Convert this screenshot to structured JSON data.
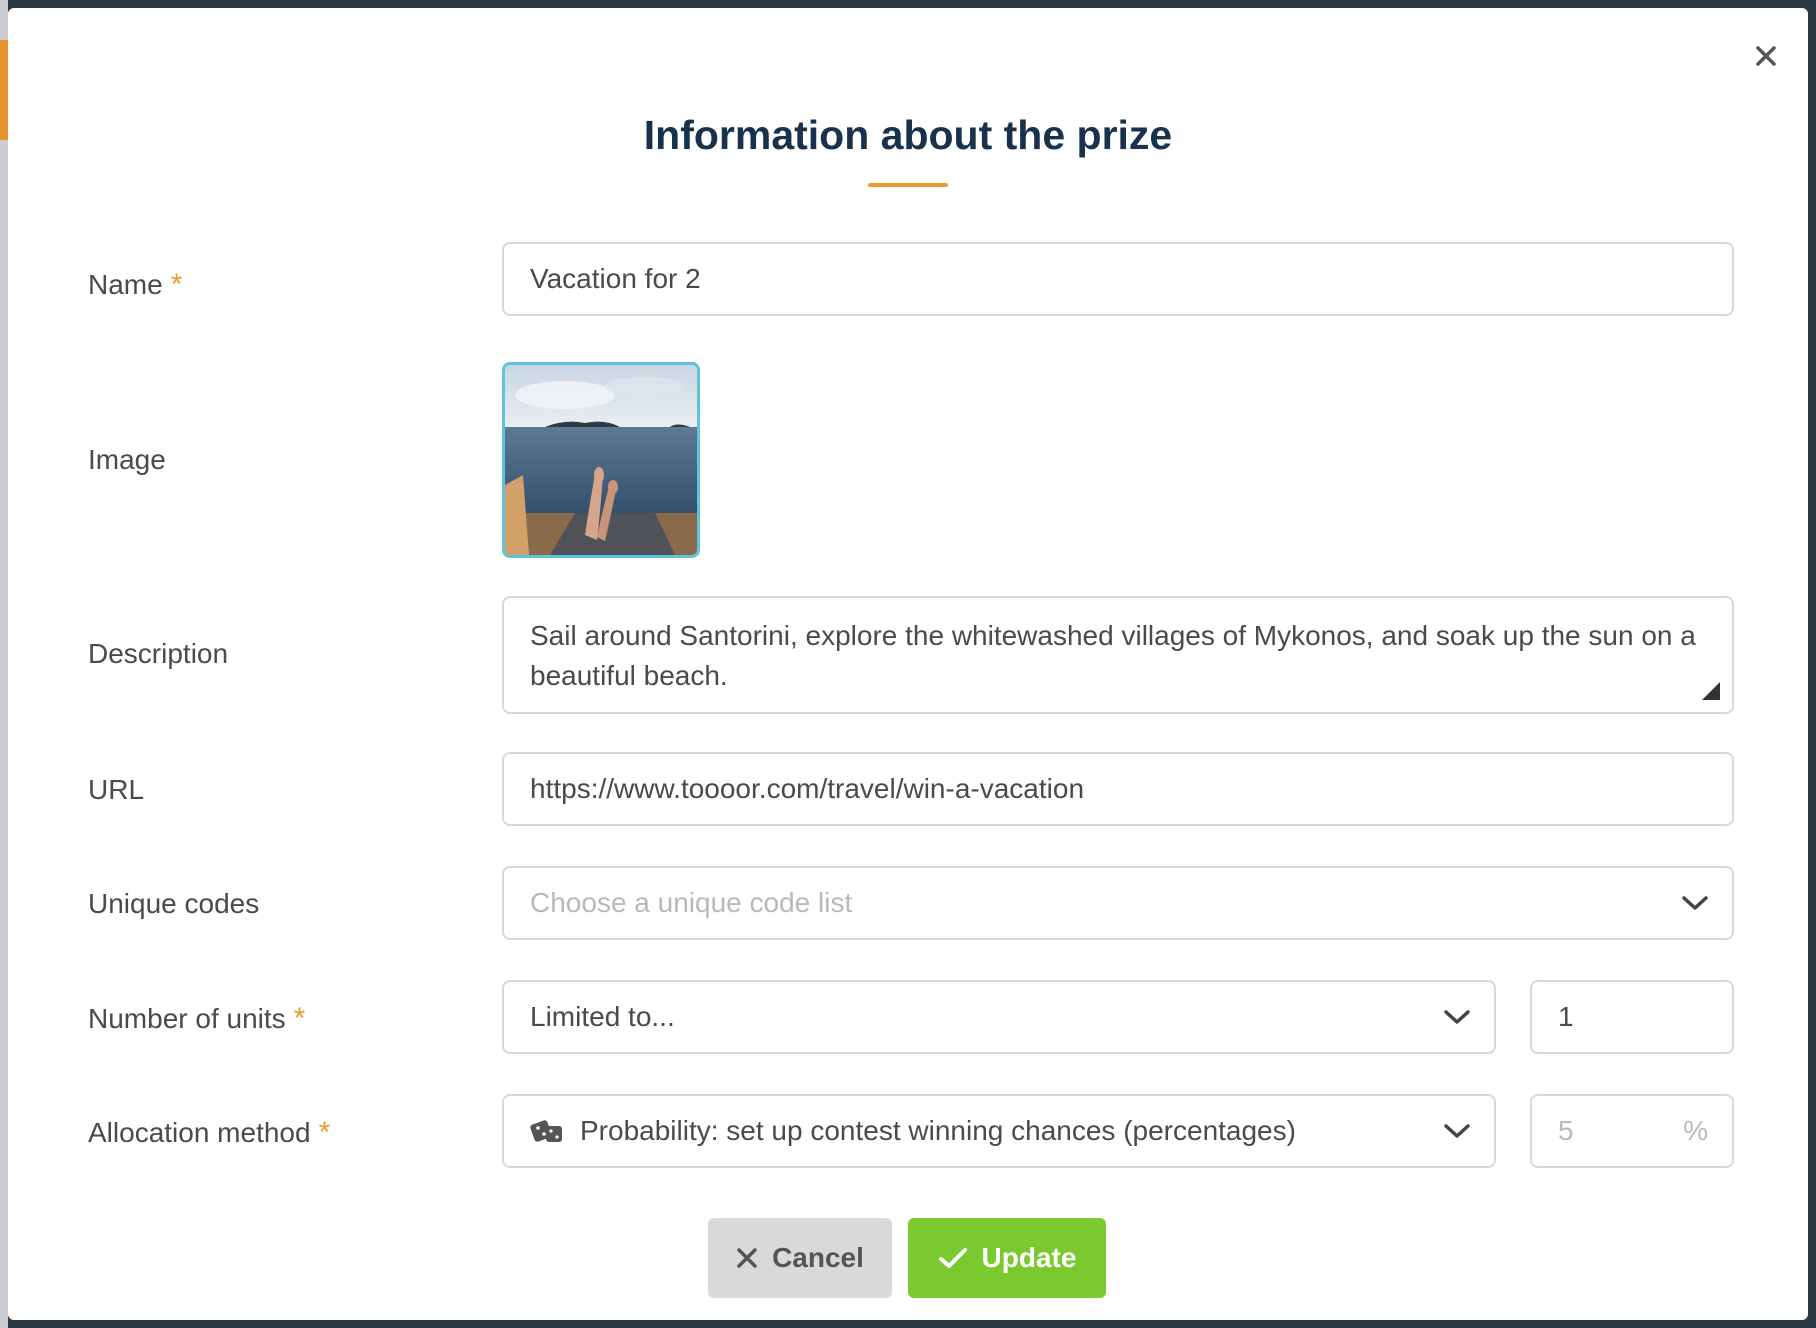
{
  "dialog": {
    "title": "Information about the prize",
    "close_label": "×"
  },
  "fields": {
    "name": {
      "label": "Name",
      "required": "*",
      "value": "Vacation for 2"
    },
    "image": {
      "label": "Image"
    },
    "description": {
      "label": "Description",
      "value": "Sail around Santorini, explore the whitewashed villages of Mykonos, and soak up the sun on a beautiful beach."
    },
    "url": {
      "label": "URL",
      "value": "https://www.toooor.com/travel/win-a-vacation"
    },
    "unique_codes": {
      "label": "Unique codes",
      "placeholder": "Choose a unique code list"
    },
    "units": {
      "label": "Number of units",
      "required": "*",
      "selected": "Limited to...",
      "value": "1"
    },
    "allocation": {
      "label": "Allocation method",
      "required": "*",
      "selected": "Probability: set up contest winning chances (percentages)",
      "percent_placeholder": "5",
      "percent_sign": "%"
    }
  },
  "buttons": {
    "cancel": "Cancel",
    "update": "Update"
  },
  "icons": {
    "close": "close-icon",
    "chevron": "chevron-down-icon",
    "dice": "dice-icon",
    "cancel": "x-icon",
    "update": "check-icon"
  },
  "colors": {
    "title": "#17324a",
    "accent": "#ef9a2c",
    "update": "#7ac92e",
    "cancel": "#d9d9d9",
    "image_border": "#5ec4dc"
  }
}
